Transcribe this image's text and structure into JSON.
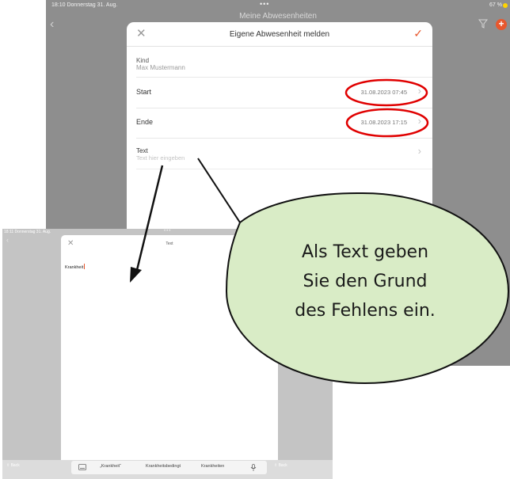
{
  "background_screen": {
    "status_time": "18:10",
    "status_date": "Donnerstag 31. Aug.",
    "status_dots": "•••",
    "status_battery": "67 %",
    "nav_title": "Meine Abwesenheiten",
    "back_icon": "chevron-left",
    "filter_icon": "filter",
    "add_icon": "plus-circle",
    "add_label": "+",
    "accent_color": "#e8572d",
    "modal": {
      "close_glyph": "✕",
      "title": "Eigene Abwesenheit melden",
      "confirm_glyph": "✓",
      "kind_label": "Kind",
      "kind_value": "Max Mustermann",
      "rows": [
        {
          "label": "Start",
          "value": "31.08.2023 07:45"
        },
        {
          "label": "Ende",
          "value": "31.08.2023 17:15"
        }
      ],
      "text_label": "Text",
      "text_placeholder": "Text hier eingeben",
      "chevron": "›"
    }
  },
  "foreground_screen": {
    "status_time": "18:11",
    "status_date": "Donnerstag 31. Aug.",
    "status_dots": "•••",
    "back_glyph": "‹",
    "sheet_close": "✕",
    "sheet_title": "Text",
    "input_value": "Krankheit",
    "keyboard_bar": {
      "left_label": "⇧ Back",
      "suggestions": [
        "„Krankheit“",
        "Krankheitsbedingt",
        "Krankheiten"
      ],
      "right_label": "⇧ Back"
    }
  },
  "annotation": {
    "bubble_lines": [
      "Als Text geben",
      "Sie den Grund",
      "des Fehlens ein."
    ],
    "bubble_fill": "#d9ecc6",
    "highlight_color": "#e00000"
  }
}
